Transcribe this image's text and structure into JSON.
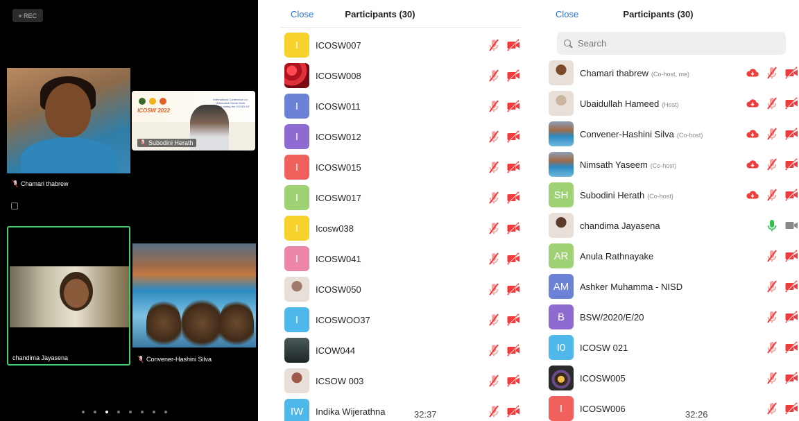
{
  "gallery": {
    "rec_label": "REC",
    "tiles": [
      {
        "name": "Chamari thabrew"
      },
      {
        "name": "Subodini Herath",
        "banner_brand": "ICOSW 2022",
        "banner_text": "International Conference on \"Alternative Social Work Practices during the COVID-19\""
      },
      {
        "name": "chandima Jayasena"
      },
      {
        "name": "Convener-Hashini Silva"
      }
    ],
    "page_count": 8,
    "active_page": 2
  },
  "panel_left": {
    "close_label": "Close",
    "title": "Participants (30)",
    "clock": "32:37",
    "participants": [
      {
        "initials": "I",
        "name": "ICOSW007",
        "color": "#f7d12c",
        "mic": "muted",
        "video": "off"
      },
      {
        "initials": "",
        "name": "ICOSW008",
        "color": "#c0202a",
        "photo": "roses",
        "mic": "muted",
        "video": "off"
      },
      {
        "initials": "I",
        "name": "ICOSW011",
        "color": "#6b82d6",
        "mic": "muted",
        "video": "off"
      },
      {
        "initials": "I",
        "name": "ICOSW012",
        "color": "#8d6bd1",
        "mic": "muted",
        "video": "off"
      },
      {
        "initials": "I",
        "name": "ICOSW015",
        "color": "#f0605c",
        "mic": "muted",
        "video": "off"
      },
      {
        "initials": "I",
        "name": "ICOSW017",
        "color": "#9fd274",
        "mic": "muted",
        "video": "off"
      },
      {
        "initials": "I",
        "name": "Icosw038",
        "color": "#f7d12c",
        "mic": "muted",
        "video": "off"
      },
      {
        "initials": "I",
        "name": "ICOSW041",
        "color": "#ec86a8",
        "mic": "muted",
        "video": "off"
      },
      {
        "initials": "",
        "name": "ICOSW050",
        "color": "#a07a6a",
        "photo": "person",
        "mic": "muted",
        "video": "off"
      },
      {
        "initials": "I",
        "name": "ICOSWOO37",
        "color": "#4fb8ea",
        "mic": "muted",
        "video": "off"
      },
      {
        "initials": "",
        "name": "ICOW044",
        "color": "#2d3a3a",
        "photo": "dark",
        "mic": "muted",
        "video": "off"
      },
      {
        "initials": "",
        "name": "ICSOW 003",
        "color": "#a05a4a",
        "photo": "person",
        "mic": "muted",
        "video": "off"
      },
      {
        "initials": "IW",
        "name": "Indika Wijerathna",
        "color": "#4fb8ea",
        "mic": "muted",
        "video": "off"
      }
    ]
  },
  "panel_right": {
    "close_label": "Close",
    "title": "Participants (30)",
    "search_placeholder": "Search",
    "clock": "32:26",
    "participants": [
      {
        "initials": "",
        "name": "Chamari thabrew",
        "role": "(Co-host, me)",
        "color": "#7a4a2a",
        "photo": "person",
        "cloud": true,
        "mic": "muted",
        "video": "off"
      },
      {
        "initials": "",
        "name": "Ubaidullah Hameed",
        "role": "(Host)",
        "color": "#c9b5a0",
        "photo": "person",
        "cloud": true,
        "mic": "muted",
        "video": "off"
      },
      {
        "initials": "",
        "name": "Convener-Hashini Silva",
        "role": "(Co-host)",
        "color": "#3b7aa4",
        "photo": "landscape",
        "cloud": true,
        "mic": "muted",
        "video": "off"
      },
      {
        "initials": "",
        "name": "Nimsath Yaseem",
        "role": "(Co-host)",
        "color": "#3b7aa4",
        "photo": "landscape",
        "cloud": true,
        "mic": "muted",
        "video": "off"
      },
      {
        "initials": "SH",
        "name": "Subodini Herath",
        "role": "(Co-host)",
        "color": "#9fd274",
        "cloud": true,
        "mic": "muted",
        "video": "off"
      },
      {
        "initials": "",
        "name": "chandima Jayasena",
        "role": "",
        "color": "#5a3a2a",
        "photo": "person",
        "cloud": false,
        "mic": "on",
        "video": "on"
      },
      {
        "initials": "AR",
        "name": "Anula Rathnayake",
        "role": "",
        "color": "#9fd274",
        "cloud": false,
        "mic": "muted",
        "video": "off"
      },
      {
        "initials": "AM",
        "name": "Ashker Muhamma - NISD",
        "role": "",
        "color": "#6b82d6",
        "cloud": false,
        "mic": "muted",
        "video": "off"
      },
      {
        "initials": "B",
        "name": "BSW/2020/E/20",
        "role": "",
        "color": "#8d6bd1",
        "cloud": false,
        "mic": "muted",
        "video": "off"
      },
      {
        "initials": "I0",
        "name": "ICOSW 021",
        "role": "",
        "color": "#4fb8ea",
        "cloud": false,
        "mic": "muted",
        "video": "off"
      },
      {
        "initials": "",
        "name": "ICOSW005",
        "role": "",
        "color": "#3a3a3a",
        "photo": "flowers",
        "cloud": false,
        "mic": "muted",
        "video": "off"
      },
      {
        "initials": "I",
        "name": "ICOSW006",
        "role": "",
        "color": "#f0605c",
        "cloud": false,
        "mic": "muted",
        "video": "off"
      }
    ]
  },
  "colors": {
    "accent": "#2d6fd6",
    "muted_red": "#ef3b3b",
    "active_green": "#3fcf6e",
    "mic_on": "#2fc24a"
  }
}
